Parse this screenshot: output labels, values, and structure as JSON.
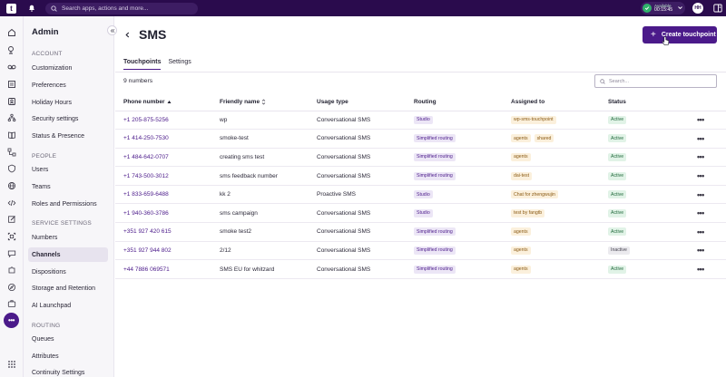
{
  "topbar": {
    "logo_text": "t",
    "search_placeholder": "Search apps, actions and more...",
    "status_label": "Available",
    "status_timer": "00:15:45",
    "avatar_initials": "HH"
  },
  "sidebar": {
    "title": "Admin",
    "sections": [
      {
        "label": "ACCOUNT",
        "items": [
          "Customization",
          "Preferences",
          "Holiday Hours",
          "Security settings",
          "Status & Presence"
        ]
      },
      {
        "label": "PEOPLE",
        "items": [
          "Users",
          "Teams",
          "Roles and Permissions"
        ]
      },
      {
        "label": "SERVICE SETTINGS",
        "items": [
          "Numbers",
          "Channels",
          "Dispositions",
          "Storage and Retention",
          "AI Launchpad"
        ]
      },
      {
        "label": "ROUTING",
        "items": [
          "Queues",
          "Attributes",
          "Continuity Settings"
        ]
      }
    ],
    "active_item": "Channels"
  },
  "main": {
    "title": "SMS",
    "create_button": "Create touchpoint",
    "tabs": [
      {
        "label": "Touchpoints",
        "active": true
      },
      {
        "label": "Settings",
        "active": false
      }
    ],
    "count": "9 numbers",
    "search_placeholder": "Search...",
    "columns": [
      "Phone number",
      "Friendly name",
      "Usage type",
      "Routing",
      "Assigned to",
      "Status"
    ],
    "rows": [
      {
        "phone": "+1 205-875-5256",
        "name": "wp",
        "usage": "Conversational SMS",
        "routing": "Studio",
        "assigned": [
          "wp-sms-touchpoint"
        ],
        "status": "Active"
      },
      {
        "phone": "+1 414-250-7530",
        "name": "smoke-test",
        "usage": "Conversational SMS",
        "routing": "Simplified routing",
        "assigned": [
          "agents",
          "shared"
        ],
        "status": "Active"
      },
      {
        "phone": "+1 484-642-0707",
        "name": "creating sms test",
        "usage": "Conversational SMS",
        "routing": "Simplified routing",
        "assigned": [
          "agents"
        ],
        "status": "Active"
      },
      {
        "phone": "+1 743-500-3012",
        "name": "sms feedback number",
        "usage": "Conversational SMS",
        "routing": "Simplified routing",
        "assigned": [
          "dai-test"
        ],
        "status": "Active"
      },
      {
        "phone": "+1 833-659-6488",
        "name": "kk 2",
        "usage": "Proactive SMS",
        "routing": "Studio",
        "assigned": [
          "Chat for zhengwujin"
        ],
        "status": "Active"
      },
      {
        "phone": "+1 940-360-3786",
        "name": "sms campaign",
        "usage": "Conversational SMS",
        "routing": "Studio",
        "assigned": [
          "test by fangtb"
        ],
        "status": "Active"
      },
      {
        "phone": "+351 927 420 615",
        "name": "smoke test2",
        "usage": "Conversational SMS",
        "routing": "Simplified routing",
        "assigned": [
          "agents"
        ],
        "status": "Active"
      },
      {
        "phone": "+351 927 944 802",
        "name": "2/12",
        "usage": "Conversational SMS",
        "routing": "Simplified routing",
        "assigned": [
          "agents"
        ],
        "status": "Inactive"
      },
      {
        "phone": "+44 7886 069571",
        "name": "SMS EU for whitzard",
        "usage": "Conversational SMS",
        "routing": "Simplified routing",
        "assigned": [
          "agents"
        ],
        "status": "Active"
      }
    ],
    "row_action": "•••"
  }
}
